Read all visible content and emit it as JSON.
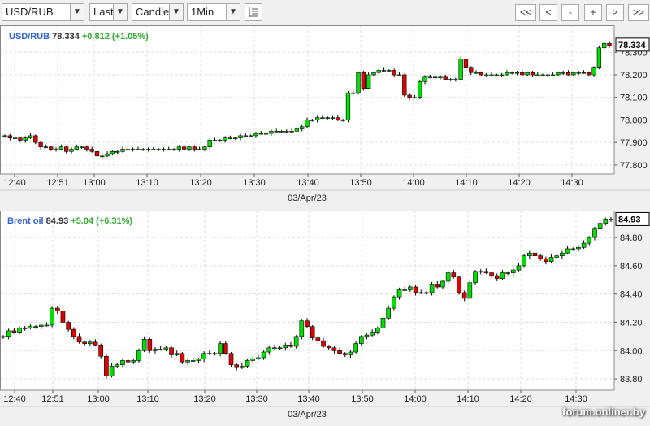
{
  "toolbar": {
    "symbol": "USD/RUB",
    "price_type": "Last",
    "chart_style": "Candle",
    "interval": "1Min",
    "nav": [
      "<<",
      "<",
      "-",
      "+",
      ">",
      ">>"
    ]
  },
  "date_label": "03/Apr/23",
  "watermark": "forum.onliner.by",
  "colors": {
    "up": "#00dd00",
    "down": "#dd0000",
    "symbol": "#3366cc",
    "change": "#33aa33"
  },
  "chart_data": [
    {
      "type": "candlestick",
      "symbol": "USD/RUB",
      "last": "78.334",
      "change": "+0.812",
      "change_pct": "(+1.05%)",
      "x_ticks": [
        "12:40",
        "12:51",
        "13:00",
        "13:10",
        "13:20",
        "13:30",
        "13:40",
        "13:50",
        "14:00",
        "14:10",
        "14:20",
        "14:30"
      ],
      "y_ticks": [
        "78.300",
        "78.200",
        "78.100",
        "78.000",
        "77.900",
        "77.800"
      ],
      "ylim": [
        77.76,
        78.42
      ],
      "close_path": [
        77.93,
        77.92,
        77.92,
        77.91,
        77.92,
        77.93,
        77.9,
        77.88,
        77.88,
        77.87,
        77.87,
        77.88,
        77.86,
        77.87,
        77.88,
        77.88,
        77.87,
        77.86,
        77.84,
        77.84,
        77.85,
        77.86,
        77.86,
        77.87,
        77.87,
        77.87,
        77.87,
        77.87,
        77.87,
        77.87,
        77.87,
        77.87,
        77.87,
        77.87,
        77.88,
        77.87,
        77.88,
        77.87,
        77.87,
        77.88,
        77.91,
        77.91,
        77.91,
        77.92,
        77.92,
        77.92,
        77.93,
        77.93,
        77.93,
        77.94,
        77.94,
        77.94,
        77.95,
        77.95,
        77.95,
        77.95,
        77.95,
        77.96,
        77.97,
        78.0,
        78.0,
        78.01,
        78.01,
        78.01,
        78.01,
        78.0,
        78.0,
        78.12,
        78.12,
        78.21,
        78.14,
        78.2,
        78.21,
        78.22,
        78.22,
        78.22,
        78.2,
        78.2,
        78.11,
        78.1,
        78.1,
        78.17,
        78.19,
        78.19,
        78.19,
        78.19,
        78.18,
        78.18,
        78.18,
        78.27,
        78.23,
        78.21,
        78.21,
        78.2,
        78.2,
        78.2,
        78.2,
        78.2,
        78.21,
        78.21,
        78.21,
        78.2,
        78.21,
        78.2,
        78.2,
        78.2,
        78.2,
        78.2,
        78.21,
        78.21,
        78.2,
        78.21,
        78.21,
        78.21,
        78.2,
        78.23,
        78.32,
        78.34,
        78.33
      ]
    },
    {
      "type": "candlestick",
      "symbol": "Brent oil",
      "last": "84.93",
      "change": "+5.04",
      "change_pct": "(+6.31%)",
      "x_ticks": [
        "12:40",
        "12:51",
        "13:00",
        "13:10",
        "13:20",
        "13:30",
        "13:40",
        "13:50",
        "14:00",
        "14:10",
        "14:20",
        "14:30"
      ],
      "y_ticks": [
        "84.80",
        "84.60",
        "84.40",
        "84.20",
        "84.00",
        "83.80"
      ],
      "ylim": [
        83.72,
        84.99
      ],
      "close_path": [
        84.1,
        84.14,
        84.13,
        84.16,
        84.16,
        84.17,
        84.17,
        84.18,
        84.18,
        84.3,
        84.28,
        84.2,
        84.15,
        84.1,
        84.06,
        84.05,
        84.06,
        84.04,
        83.96,
        83.82,
        83.89,
        83.9,
        83.93,
        83.92,
        83.93,
        84.0,
        84.08,
        84.0,
        84.01,
        84.01,
        84.02,
        83.97,
        83.98,
        83.92,
        83.93,
        83.93,
        83.94,
        83.98,
        83.98,
        83.98,
        84.05,
        83.98,
        83.9,
        83.88,
        83.89,
        83.93,
        83.94,
        83.95,
        83.99,
        84.02,
        84.02,
        84.02,
        84.04,
        84.03,
        84.1,
        84.21,
        84.17,
        84.09,
        84.07,
        84.03,
        84.02,
        84.0,
        83.98,
        83.97,
        83.99,
        84.05,
        84.1,
        84.11,
        84.13,
        84.16,
        84.23,
        84.3,
        84.38,
        84.43,
        84.43,
        84.45,
        84.41,
        84.41,
        84.41,
        84.47,
        84.45,
        84.49,
        84.55,
        84.52,
        84.41,
        84.37,
        84.48,
        84.56,
        84.56,
        84.55,
        84.53,
        84.51,
        84.55,
        84.55,
        84.57,
        84.6,
        84.67,
        84.69,
        84.67,
        84.65,
        84.63,
        84.66,
        84.67,
        84.69,
        84.72,
        84.72,
        84.73,
        84.76,
        84.8,
        84.86,
        84.9,
        84.93,
        84.93
      ]
    }
  ]
}
